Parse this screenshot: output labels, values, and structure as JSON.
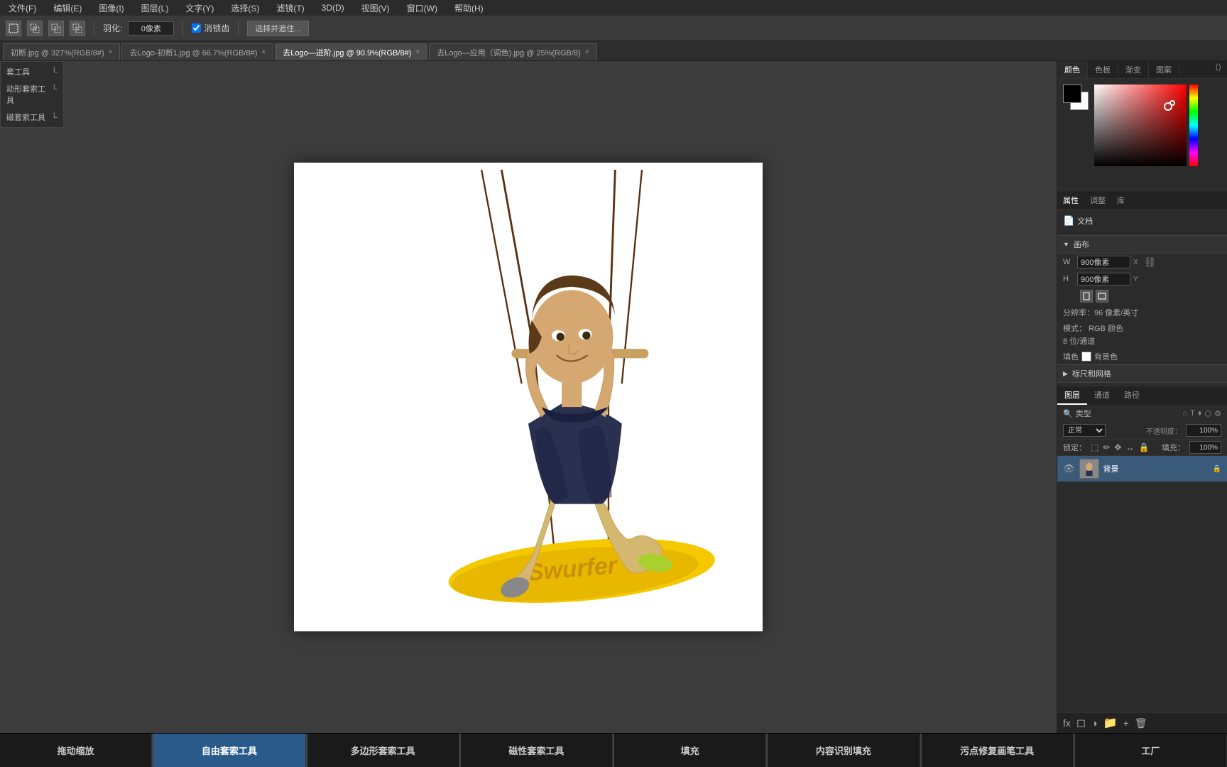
{
  "menubar": {
    "items": [
      "文件(F)",
      "编辑(E)",
      "图像(I)",
      "图层(L)",
      "文字(Y)",
      "选择(S)",
      "滤镜(T)",
      "3D(D)",
      "视图(V)",
      "窗口(W)",
      "帮助(H)"
    ]
  },
  "toolbar": {
    "feather_label": "羽化:",
    "feather_value": "0像素",
    "antialias_label": "消锁齿",
    "select_btn": "选择并遮住..."
  },
  "tabs": [
    {
      "id": "tab1",
      "label": "初断.jpg @ 327%(RGB/8#)",
      "active": false
    },
    {
      "id": "tab2",
      "label": "去Logo-初断1.jpg @ 66.7%(RGB/8#)",
      "active": false
    },
    {
      "id": "tab3",
      "label": "去Logo—进阶.jpg @ 90.9%(RGB/8#)",
      "active": true
    },
    {
      "id": "tab4",
      "label": "去Logo—应用（调色).jpg @ 25%(RGB/8)",
      "active": false
    }
  ],
  "tools_labels": [
    {
      "name": "套工具",
      "key": "L"
    },
    {
      "name": "动形套索工具",
      "key": "L"
    },
    {
      "name": "磁套索工具",
      "key": "L"
    }
  ],
  "color_section": {
    "tabs": [
      "颜色",
      "色板",
      "渐变",
      "图案"
    ],
    "active_tab": "颜色"
  },
  "props_section": {
    "tabs": [
      "属性",
      "调整",
      "库"
    ],
    "active_tab": "属性",
    "doc_label": "文档",
    "canvas_section": "画布",
    "width_label": "W",
    "width_value": "900像素",
    "width_unit": "X",
    "height_label": "H",
    "height_value": "900像素",
    "height_unit": "Y",
    "resolution_label": "分辨率：96 像素/英寸",
    "mode_label": "模式：",
    "mode_value": "RGB 颜色",
    "bit_label": "8 位/通道",
    "fill_label": "填色",
    "bg_label": "背景色",
    "rulers_section": "标尺和网格"
  },
  "layers_section": {
    "tabs": [
      "图层",
      "通道",
      "路径"
    ],
    "active_tab": "图层",
    "search_placeholder": "类型",
    "blend_mode": "正常",
    "opacity_label": "不透明度：",
    "opacity_value": "100%",
    "lock_label": "锁定：",
    "fill_label": "填充：",
    "fill_value": "100%",
    "layer_name": "背景"
  },
  "bottom_toolbar": {
    "tools": [
      {
        "id": "drag",
        "label": "拖动缩放",
        "active": false
      },
      {
        "id": "lasso",
        "label": "自由套索工具",
        "active": true
      },
      {
        "id": "poly-lasso",
        "label": "多边形套索工具",
        "active": false
      },
      {
        "id": "mag-lasso",
        "label": "磁性套索工具",
        "active": false
      },
      {
        "id": "fill",
        "label": "填充",
        "active": false
      },
      {
        "id": "content-fill",
        "label": "内容识别填充",
        "active": false
      },
      {
        "id": "spot-heal",
        "label": "污点修复画笔工具",
        "active": false
      },
      {
        "id": "factory",
        "label": "工厂",
        "active": false
      }
    ]
  },
  "canvas": {
    "zoom": "90.9%",
    "image_description": "Boy on yellow Swurfer swing"
  }
}
